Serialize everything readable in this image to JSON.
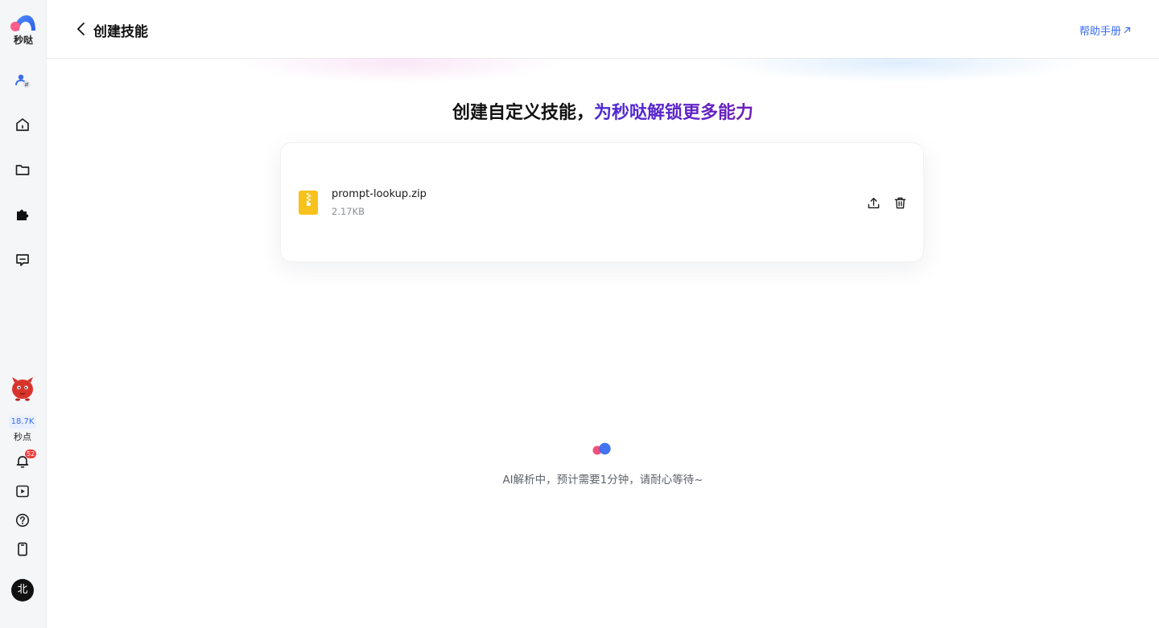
{
  "sidebar": {
    "brand": "秒哒",
    "icons": {
      "switch": "user-switch-icon",
      "home": "home-icon",
      "folder": "folder-icon",
      "plugin": "puzzle-icon",
      "chat": "message-icon",
      "bell": "bell-icon",
      "video": "play-icon",
      "help": "question-icon",
      "mobile": "phone-icon"
    },
    "points_value": "18.7K",
    "points_label": "秒点",
    "notification_count": "52",
    "avatar_initial": "北"
  },
  "header": {
    "title": "创建技能",
    "help_link": "帮助手册"
  },
  "main": {
    "headline_prefix": "创建自定义技能，",
    "headline_accent": "为秒哒解锁更多能力",
    "file": {
      "name": "prompt-lookup.zip",
      "size": "2.17KB",
      "icon": "zip-file-icon"
    },
    "status": "AI解析中，预计需要1分钟，请耐心等待~"
  },
  "colors": {
    "link": "#3a6df0",
    "accent_start": "#4b2bd9",
    "accent_end": "#6e1fb8",
    "badge": "#f03f3f",
    "file_icon": "#f7c21c"
  }
}
